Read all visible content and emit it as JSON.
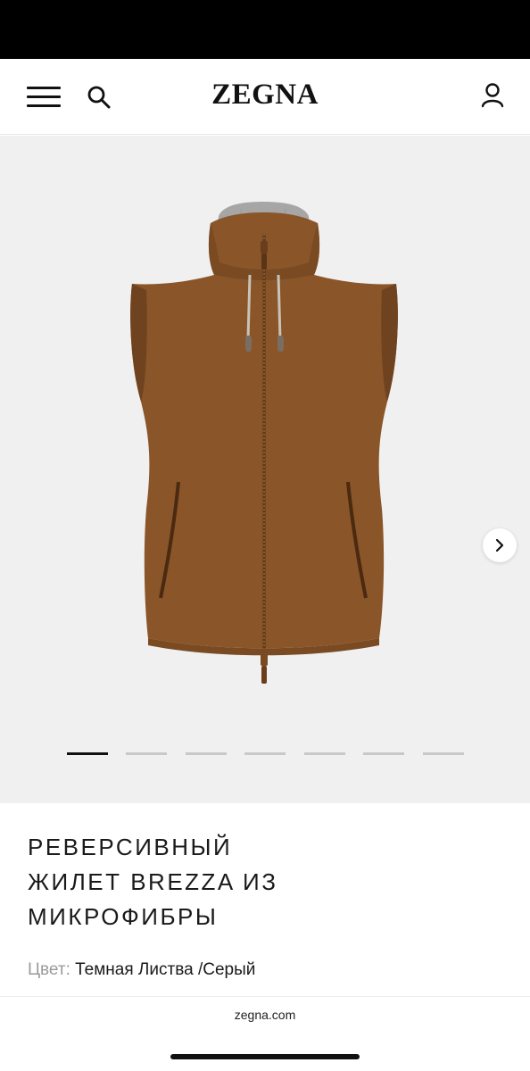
{
  "header": {
    "logo": "ZEGNA",
    "menu_icon": "hamburger-menu-icon",
    "search_icon": "search-icon",
    "account_icon": "user-account-icon"
  },
  "gallery": {
    "next_icon": "chevron-right-icon",
    "slide_count": 7,
    "active_slide": 1
  },
  "product": {
    "title_lines": [
      "РЕВЕРСИВНЫЙ",
      "ЖИЛЕТ BREZZA ИЗ",
      "МИКРОФИБРЫ"
    ],
    "color_label": "Цвет:",
    "color_value": "Темная Листва /Серый"
  },
  "browser": {
    "url": "zegna.com"
  },
  "colors": {
    "vest": "#8a5528",
    "lining": "#a6a6a6",
    "gallery_bg": "#f0f0f0"
  }
}
